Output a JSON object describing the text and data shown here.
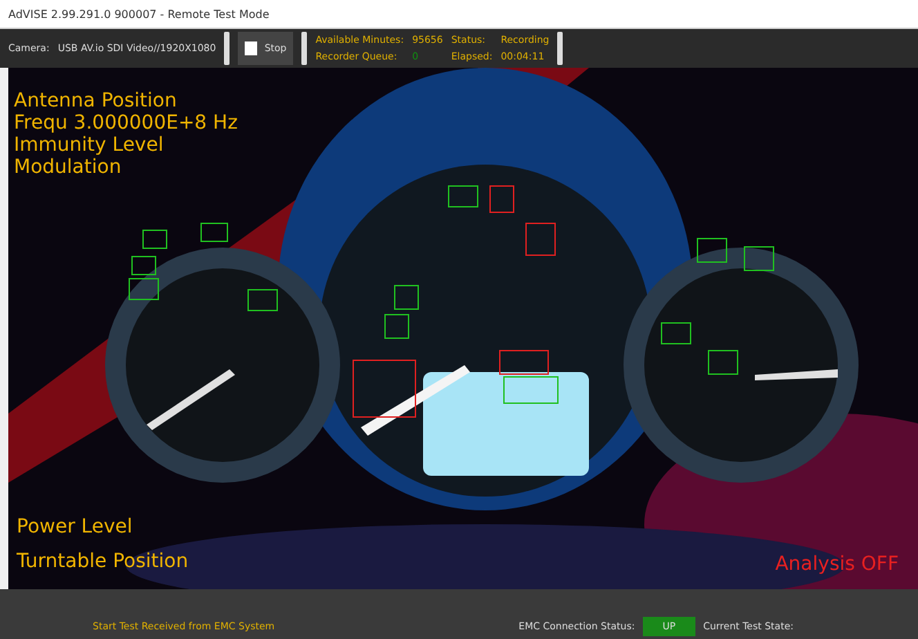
{
  "window": {
    "title": "AdVISE 2.99.291.0 900007 - Remote Test Mode"
  },
  "toolbar": {
    "camera_label": "Camera:",
    "camera_value": "USB AV.io SDI Video//1920X1080",
    "stop_button": {
      "label": "Stop",
      "checked": false
    },
    "status": [
      {
        "label": "Available Minutes:",
        "value": "95656",
        "color": "#e0b000"
      },
      {
        "label": "Status:",
        "value": "Recording",
        "color": "#e0b000"
      },
      {
        "label": "Recorder Queue:",
        "value": "0",
        "color": "#109010"
      },
      {
        "label": "Elapsed:",
        "value": "00:04:11",
        "color": "#e0b000"
      }
    ]
  },
  "overlay": {
    "top_lines": [
      "Antenna Position",
      "Frequ 3.000000E+8 Hz",
      "Immunity Level",
      "Modulation"
    ],
    "bottom_lines": [
      "Power Level",
      "Turntable Position"
    ],
    "analysis": "Analysis OFF",
    "detections": [
      {
        "color": "#20c020"
      },
      {
        "color": "#20c020"
      },
      {
        "color": "#20c020"
      },
      {
        "color": "#20c020"
      },
      {
        "color": "#20c020"
      },
      {
        "color": "#20c020"
      },
      {
        "color": "#20c020"
      },
      {
        "color": "#20c020"
      },
      {
        "color": "#e02020"
      },
      {
        "color": "#e02020"
      },
      {
        "color": "#e02020"
      },
      {
        "color": "#20c020"
      },
      {
        "color": "#20c020"
      },
      {
        "color": "#20c020"
      },
      {
        "color": "#20c020"
      },
      {
        "color": "#e02020"
      },
      {
        "color": "#20c020"
      }
    ]
  },
  "status_bar": {
    "message": "Start Test Received from EMC System",
    "connection_label": "EMC Connection Status:",
    "connection_value": "UP",
    "state_label": "Current Test State:"
  }
}
